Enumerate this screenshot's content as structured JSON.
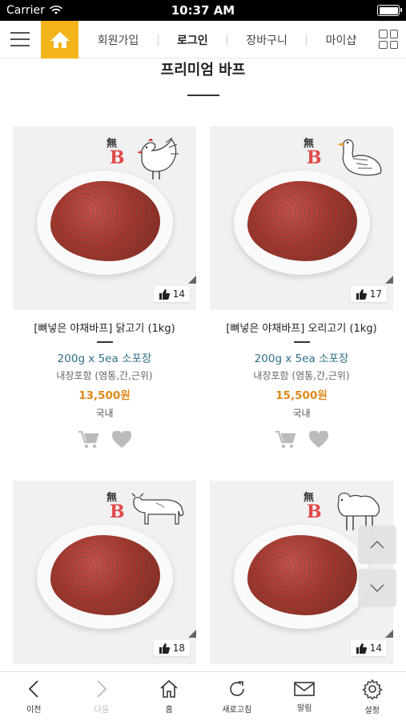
{
  "status_bar": {
    "carrier": "Carrier",
    "time": "10:37 AM"
  },
  "top_nav": {
    "links": [
      "회원가입",
      "로그인",
      "장바구니",
      "마이샵"
    ]
  },
  "section": {
    "title": "프리미엄 바프"
  },
  "brand": {
    "mu": "無",
    "logo_letter": "B"
  },
  "products": [
    {
      "name": "[뼈넣은 야채바프] 닭고기 (1kg)",
      "pack": "200g x 5ea 소포장",
      "desc": "내장포함 (염통,간,근위)",
      "price": "13,500원",
      "origin": "국내",
      "likes": "14",
      "animal": "rooster"
    },
    {
      "name": "[뼈넣은 야채바프] 오리고기 (1kg)",
      "pack": "200g x 5ea 소포장",
      "desc": "내장포함 (염통,간,근위)",
      "price": "15,500원",
      "origin": "국내",
      "likes": "17",
      "animal": "duck"
    },
    {
      "name": "",
      "pack": "",
      "desc": "",
      "price": "",
      "origin": "",
      "likes": "18",
      "animal": "cow"
    },
    {
      "name": "",
      "pack": "",
      "desc": "",
      "price": "",
      "origin": "",
      "likes": "14",
      "animal": "sheep"
    }
  ],
  "bottom_bar": {
    "tabs": [
      {
        "label": "이전",
        "icon": "chevron-left-icon"
      },
      {
        "label": "다음",
        "icon": "chevron-right-icon"
      },
      {
        "label": "홈",
        "icon": "home-icon"
      },
      {
        "label": "새로고침",
        "icon": "refresh-icon"
      },
      {
        "label": "알림",
        "icon": "mail-icon"
      },
      {
        "label": "설정",
        "icon": "gear-icon"
      }
    ]
  },
  "colors": {
    "accent": "#f3b41b",
    "price": "#e0891a",
    "pack": "#2f6f86"
  }
}
